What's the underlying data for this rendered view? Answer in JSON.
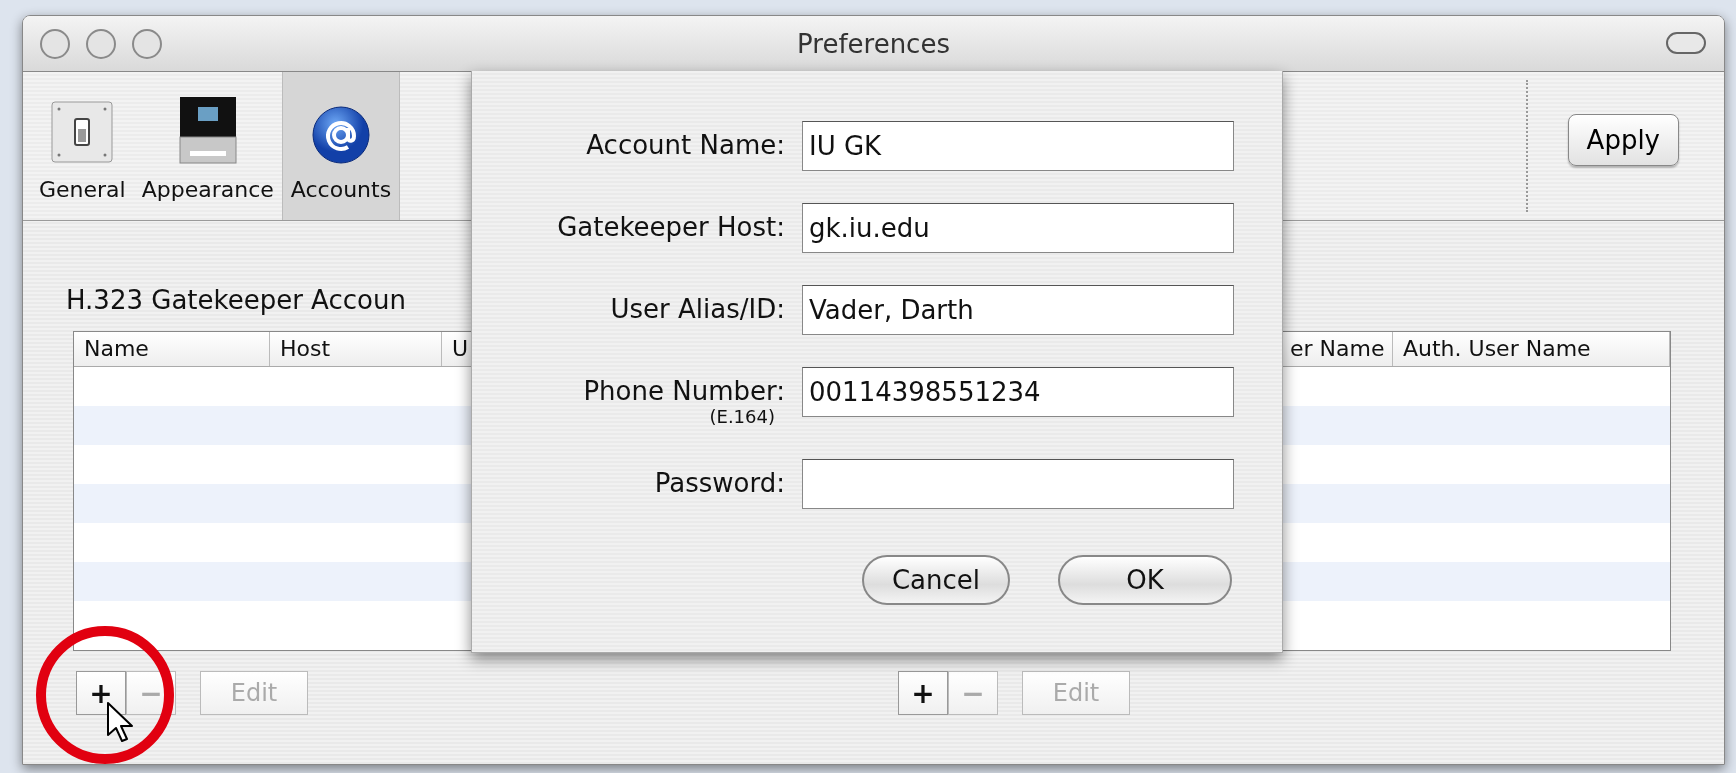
{
  "window": {
    "title": "Preferences"
  },
  "toolbar": {
    "items": [
      {
        "label": "General",
        "kind": "switch",
        "selected": false
      },
      {
        "label": "Appearance",
        "kind": "monitor",
        "selected": false
      },
      {
        "label": "Accounts",
        "kind": "at-sign",
        "selected": true
      }
    ],
    "apply_button": "Apply"
  },
  "gatekeeper_accounts": {
    "title": "H.323 Gatekeeper Accoun",
    "columns": [
      "Name",
      "Host",
      "U"
    ],
    "buttons": [
      {
        "label": "+",
        "kind": "add",
        "disabled": false
      },
      {
        "label": "−",
        "kind": "remove",
        "disabled": true
      },
      {
        "label": "Edit",
        "kind": "edit",
        "disabled": true
      }
    ]
  },
  "sip_accounts": {
    "columns": [
      "er Name",
      "Auth. User Name"
    ],
    "buttons": [
      {
        "label": "+",
        "kind": "add",
        "disabled": false
      },
      {
        "label": "−",
        "kind": "remove",
        "disabled": true
      },
      {
        "label": "Edit",
        "kind": "edit",
        "disabled": true
      }
    ]
  },
  "sheet": {
    "fields": [
      {
        "label": "Account Name:",
        "value": "IU GK"
      },
      {
        "label": "Gatekeeper Host:",
        "value": "gk.iu.edu"
      },
      {
        "label": "User Alias/ID:",
        "value": "Vader, Darth"
      },
      {
        "label": "Phone Number:",
        "note": "(E.164)",
        "value": "00114398551234"
      },
      {
        "label": "Password:"
      }
    ],
    "buttons": [
      "Cancel",
      "OK"
    ]
  }
}
